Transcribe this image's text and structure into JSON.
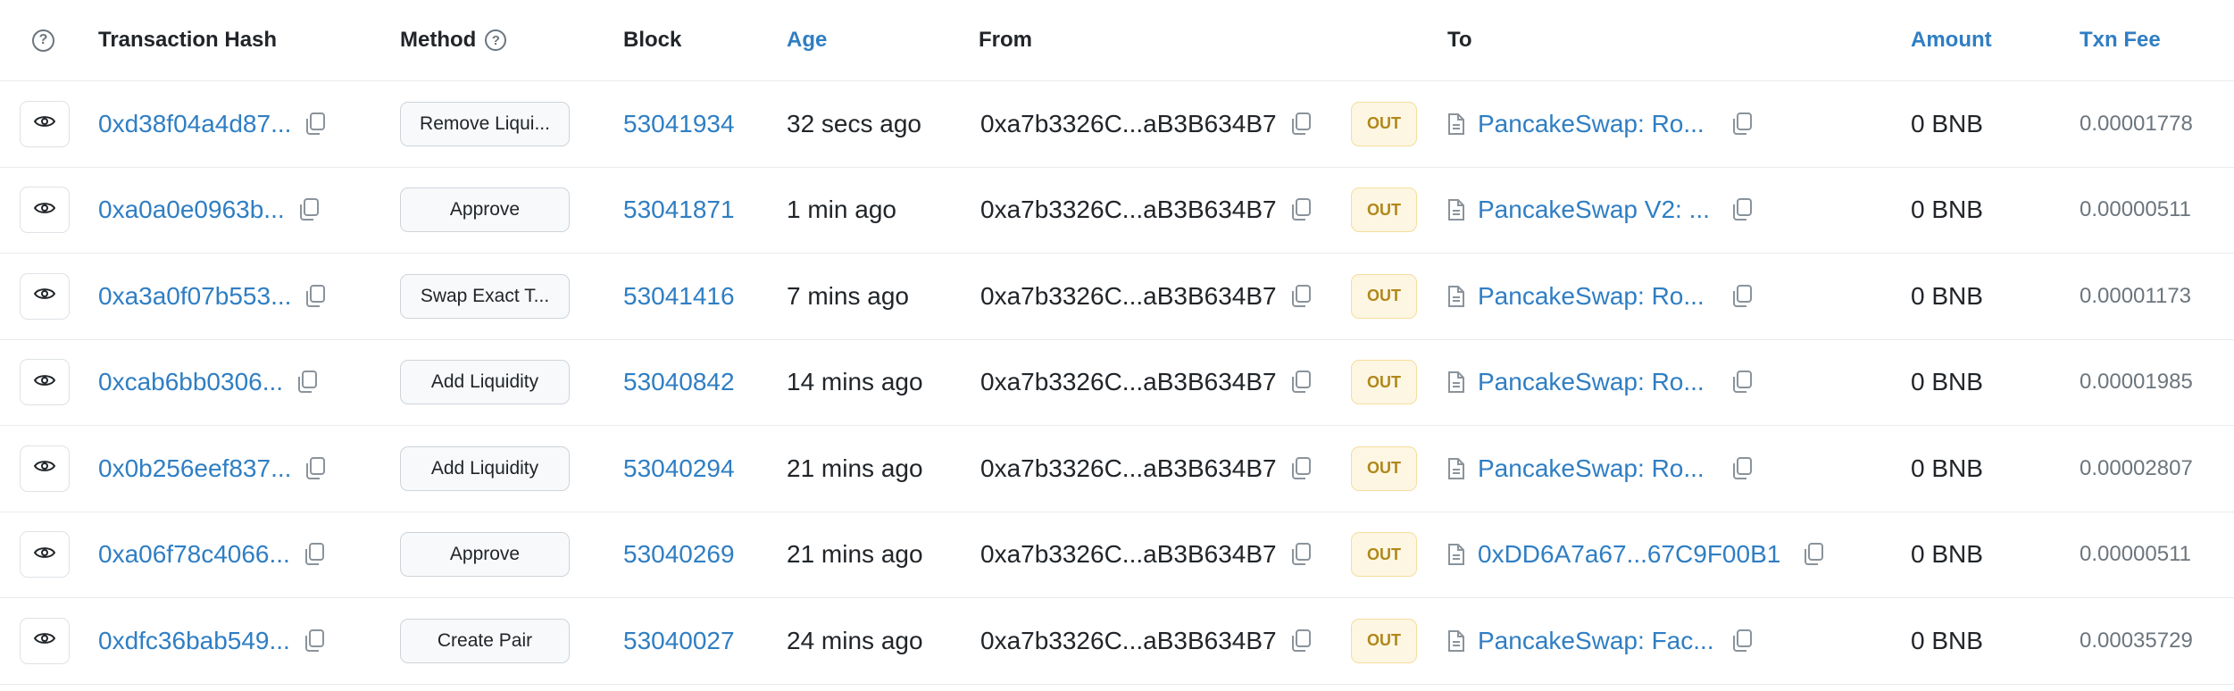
{
  "header": {
    "help_icon": "question-circle-icon",
    "transaction_hash": "Transaction Hash",
    "method": "Method",
    "method_help_icon": "question-circle-icon",
    "block": "Block",
    "age": "Age",
    "from": "From",
    "to": "To",
    "amount": "Amount",
    "txn_fee": "Txn Fee"
  },
  "colors": {
    "link": "#2f7ec3",
    "out_badge_bg": "#fdf6e3",
    "out_badge_text": "#b0881a",
    "border": "#e9ecef"
  },
  "rows": [
    {
      "hash": "0xd38f04a4d87...",
      "method": "Remove Liqui...",
      "block": "53041934",
      "age": "32 secs ago",
      "from": "0xa7b3326C...aB3B634B7",
      "direction": "OUT",
      "to": "PancakeSwap: Ro...",
      "amount": "0 BNB",
      "fee": "0.00001778"
    },
    {
      "hash": "0xa0a0e0963b...",
      "method": "Approve",
      "block": "53041871",
      "age": "1 min ago",
      "from": "0xa7b3326C...aB3B634B7",
      "direction": "OUT",
      "to": "PancakeSwap V2: ...",
      "amount": "0 BNB",
      "fee": "0.00000511"
    },
    {
      "hash": "0xa3a0f07b553...",
      "method": "Swap Exact T...",
      "block": "53041416",
      "age": "7 mins ago",
      "from": "0xa7b3326C...aB3B634B7",
      "direction": "OUT",
      "to": "PancakeSwap: Ro...",
      "amount": "0 BNB",
      "fee": "0.00001173"
    },
    {
      "hash": "0xcab6bb0306...",
      "method": "Add Liquidity",
      "block": "53040842",
      "age": "14 mins ago",
      "from": "0xa7b3326C...aB3B634B7",
      "direction": "OUT",
      "to": "PancakeSwap: Ro...",
      "amount": "0 BNB",
      "fee": "0.00001985"
    },
    {
      "hash": "0x0b256eef837...",
      "method": "Add Liquidity",
      "block": "53040294",
      "age": "21 mins ago",
      "from": "0xa7b3326C...aB3B634B7",
      "direction": "OUT",
      "to": "PancakeSwap: Ro...",
      "amount": "0 BNB",
      "fee": "0.00002807"
    },
    {
      "hash": "0xa06f78c4066...",
      "method": "Approve",
      "block": "53040269",
      "age": "21 mins ago",
      "from": "0xa7b3326C...aB3B634B7",
      "direction": "OUT",
      "to": "0xDD6A7a67...67C9F00B1",
      "amount": "0 BNB",
      "fee": "0.00000511"
    },
    {
      "hash": "0xdfc36bab549...",
      "method": "Create Pair",
      "block": "53040027",
      "age": "24 mins ago",
      "from": "0xa7b3326C...aB3B634B7",
      "direction": "OUT",
      "to": "PancakeSwap: Fac...",
      "amount": "0 BNB",
      "fee": "0.00035729"
    }
  ]
}
